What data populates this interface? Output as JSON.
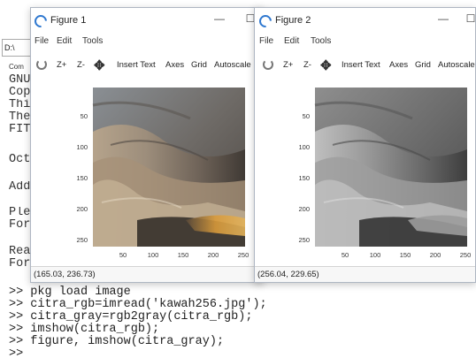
{
  "console": {
    "path": "D:\\",
    "tab_label": "Com",
    "log_lines": [
      "GNU",
      "Cop",
      "Thi",
      "The",
      "FIT",
      "",
      "Oct",
      "",
      "Add",
      "",
      "Ple",
      "For",
      "",
      "Rea",
      "For"
    ],
    "commands": [
      ">> pkg load image",
      ">> citra_rgb=imread('kawah256.jpg');",
      ">> citra_gray=rgb2gray(citra_rgb);",
      ">> imshow(citra_rgb);",
      ">> figure, imshow(citra_gray);",
      ">>"
    ]
  },
  "figure1": {
    "title": "Figure 1",
    "minimize": "—",
    "maximize": "☐",
    "menu": [
      "File",
      "Edit",
      "Tools"
    ],
    "toolbar": [
      "Z+",
      "Z-",
      "Insert Text",
      "Axes",
      "Grid",
      "Autoscale"
    ],
    "x_ticks": [
      "50",
      "100",
      "150",
      "200",
      "250"
    ],
    "y_ticks": [
      "50",
      "100",
      "150",
      "200",
      "250"
    ],
    "status": "(165.03, 236.73)",
    "image": "crater-landscape-color"
  },
  "figure2": {
    "title": "Figure 2",
    "minimize": "—",
    "maximize": "☐",
    "menu": [
      "File",
      "Edit",
      "Tools"
    ],
    "toolbar": [
      "Z+",
      "Z-",
      "Insert Text",
      "Axes",
      "Grid",
      "Autoscale"
    ],
    "x_ticks": [
      "50",
      "100",
      "150",
      "200",
      "250"
    ],
    "y_ticks": [
      "50",
      "100",
      "150",
      "200",
      "250"
    ],
    "status": "(256.04, 229.65)",
    "image": "crater-landscape-grayscale"
  },
  "colors": {
    "octave_blue": "#2f78d0",
    "window_border": "#aeb6c2"
  }
}
